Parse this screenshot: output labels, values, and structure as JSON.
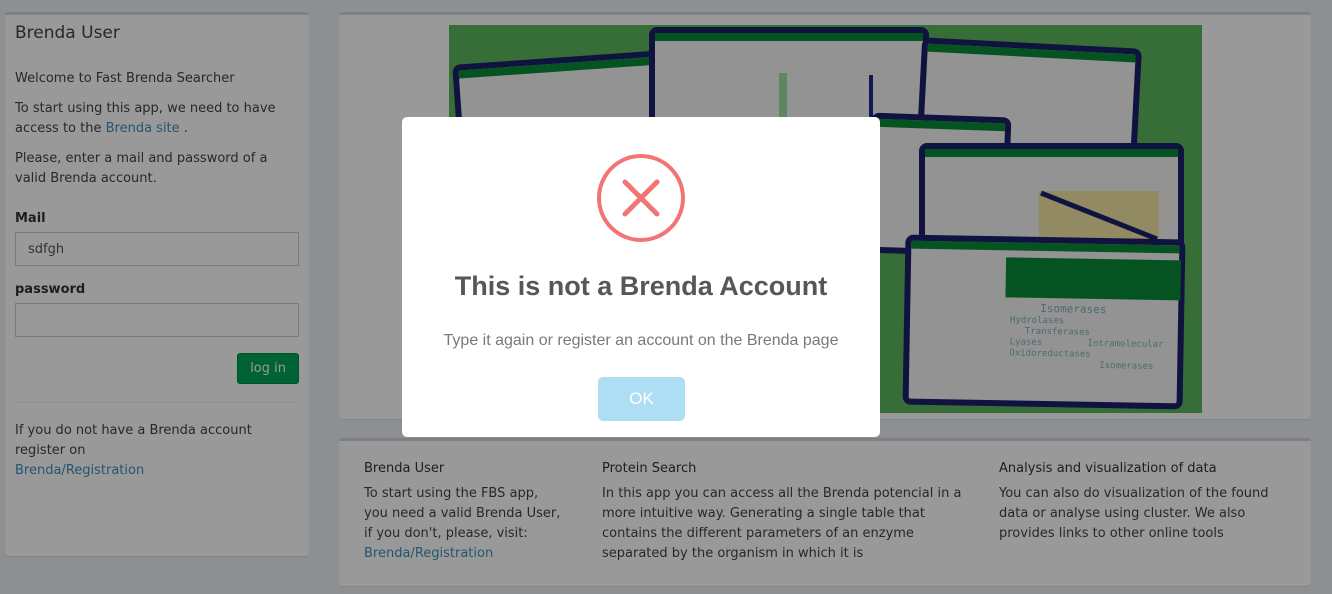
{
  "sidebar": {
    "title": "Brenda User",
    "welcome": "Welcome to Fast Brenda Searcher",
    "intro_text": "To start using this app, we need to have access to the",
    "intro_link": "Brenda site",
    "intro_end": ".",
    "instructions": "Please, enter a mail and password of a valid Brenda account.",
    "mail_label": "Mail",
    "mail_value": "sdfgh",
    "password_label": "password",
    "password_value": "",
    "login_label": "log in",
    "register_text": "If you do not have a Brenda account register on",
    "register_link": "Brenda/Registration"
  },
  "info": {
    "col1": {
      "title": "Brenda User",
      "text": "To start using the FBS app, you need a valid Brenda User, if you don't, please, visit:",
      "link": "Brenda/Registration"
    },
    "col2": {
      "title": "Protein Search",
      "text": "In this app you can access all the Brenda potencial in a more intuitive way. Generating a single table that contains the different parameters of an enzyme separated by the organism in which it is"
    },
    "col3": {
      "title": "Analysis and visualization of data",
      "text": "You can also do visualization of the found data or analyse using cluster. We also provides links to other online tools"
    }
  },
  "hero_words": [
    "Isomerases",
    "Hydrolases",
    "Transferases",
    "Lyases",
    "Intramolecular",
    "Oxidoreductases",
    "Isomerases"
  ],
  "modal": {
    "icon": "error-x-icon",
    "title": "This is not a Brenda Account",
    "message": "Type it again or register an account on the Brenda page",
    "ok_label": "OK"
  },
  "colors": {
    "error": "#f27474",
    "ok_button": "#aedef4",
    "login_button": "#00a65a",
    "link": "#3c8dbc"
  }
}
